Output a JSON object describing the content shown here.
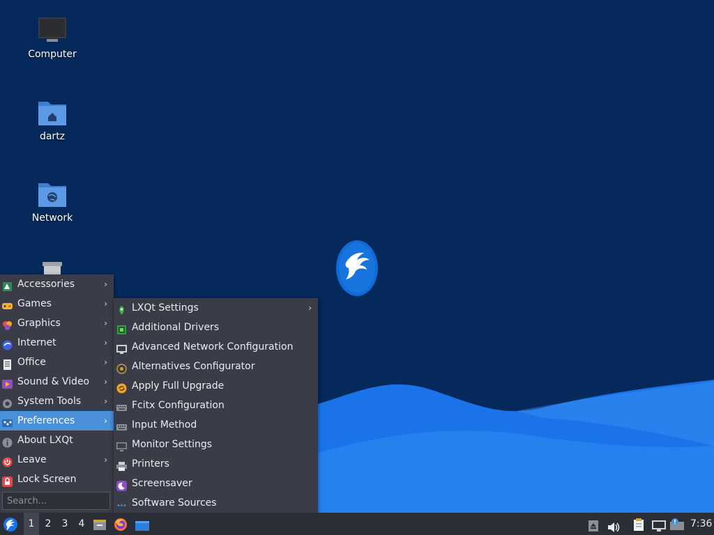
{
  "desktop": {
    "icons": [
      {
        "label": "Computer",
        "icon": "computer-icon"
      },
      {
        "label": "dartz",
        "icon": "home-folder-icon"
      },
      {
        "label": "Network",
        "icon": "network-folder-icon"
      },
      {
        "label": "",
        "icon": "trash-icon"
      }
    ],
    "colors": {
      "background": "#04295a",
      "wave": "#1a73e8",
      "wave_light": "#2f8cf0"
    }
  },
  "main_menu": {
    "items": [
      {
        "label": "Accessories",
        "icon": "accessories-icon",
        "submenu": true
      },
      {
        "label": "Games",
        "icon": "games-icon",
        "submenu": true
      },
      {
        "label": "Graphics",
        "icon": "graphics-icon",
        "submenu": true
      },
      {
        "label": "Internet",
        "icon": "internet-icon",
        "submenu": true
      },
      {
        "label": "Office",
        "icon": "office-icon",
        "submenu": true
      },
      {
        "label": "Sound & Video",
        "icon": "sound-video-icon",
        "submenu": true
      },
      {
        "label": "System Tools",
        "icon": "system-tools-icon",
        "submenu": true
      },
      {
        "label": "Preferences",
        "icon": "preferences-icon",
        "submenu": true,
        "active": true
      },
      {
        "label": "About LXQt",
        "icon": "info-icon",
        "submenu": false
      },
      {
        "label": "Leave",
        "icon": "power-icon",
        "submenu": true
      },
      {
        "label": "Lock Screen",
        "icon": "lock-icon",
        "submenu": false
      }
    ],
    "arrow": "›",
    "search_placeholder": "Search..."
  },
  "preferences_menu": {
    "items": [
      {
        "label": "LXQt Settings",
        "icon": "lxqt-settings-icon",
        "submenu": true
      },
      {
        "label": "Additional Drivers",
        "icon": "drivers-icon",
        "submenu": false
      },
      {
        "label": "Advanced Network Configuration",
        "icon": "network-config-icon",
        "submenu": false
      },
      {
        "label": "Alternatives Configurator",
        "icon": "alternatives-icon",
        "submenu": false
      },
      {
        "label": "Apply Full Upgrade",
        "icon": "upgrade-icon",
        "submenu": false
      },
      {
        "label": "Fcitx Configuration",
        "icon": "keyboard-icon",
        "submenu": false
      },
      {
        "label": "Input Method",
        "icon": "keyboard-icon",
        "submenu": false
      },
      {
        "label": "Monitor Settings",
        "icon": "monitor-icon",
        "submenu": false
      },
      {
        "label": "Printers",
        "icon": "printer-icon",
        "submenu": false
      },
      {
        "label": "Screensaver",
        "icon": "screensaver-icon",
        "submenu": false
      },
      {
        "label": "Software Sources",
        "icon": "software-sources-icon",
        "submenu": false
      }
    ]
  },
  "taskbar": {
    "workspaces": [
      "1",
      "2",
      "3",
      "4"
    ],
    "active_workspace": "1",
    "clock": "7:36",
    "launchers": [
      "file-manager-icon",
      "firefox-icon",
      "desktop-icon"
    ],
    "tray": [
      "eject-icon",
      "volume-icon",
      "clipboard-icon",
      "network-icon",
      "update-notifier-icon"
    ]
  }
}
